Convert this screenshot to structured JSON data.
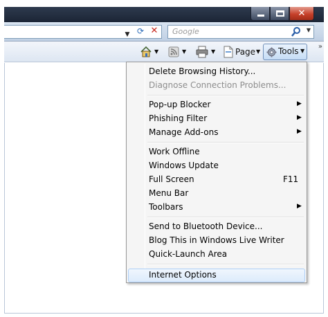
{
  "window": {
    "close_glyph": "✕"
  },
  "addressbar": {
    "search_placeholder": "Google"
  },
  "commandbar": {
    "page_label": "Page",
    "tools_label": "Tools",
    "more_chevron": "»"
  },
  "menu": {
    "groups": [
      [
        {
          "label": "Delete Browsing History...",
          "disabled": false
        },
        {
          "label": "Diagnose Connection Problems...",
          "disabled": true
        }
      ],
      [
        {
          "label": "Pop-up Blocker",
          "submenu": true
        },
        {
          "label": "Phishing Filter",
          "submenu": true
        },
        {
          "label": "Manage Add-ons",
          "submenu": true
        }
      ],
      [
        {
          "label": "Work Offline"
        },
        {
          "label": "Windows Update"
        },
        {
          "label": "Full Screen",
          "shortcut": "F11"
        },
        {
          "label": "Menu Bar"
        },
        {
          "label": "Toolbars",
          "submenu": true
        }
      ],
      [
        {
          "label": "Send to Bluetooth Device..."
        },
        {
          "label": "Blog This in Windows Live Writer"
        },
        {
          "label": "Quick-Launch Area"
        }
      ],
      [
        {
          "label": "Internet Options",
          "highlighted": true
        }
      ]
    ]
  }
}
